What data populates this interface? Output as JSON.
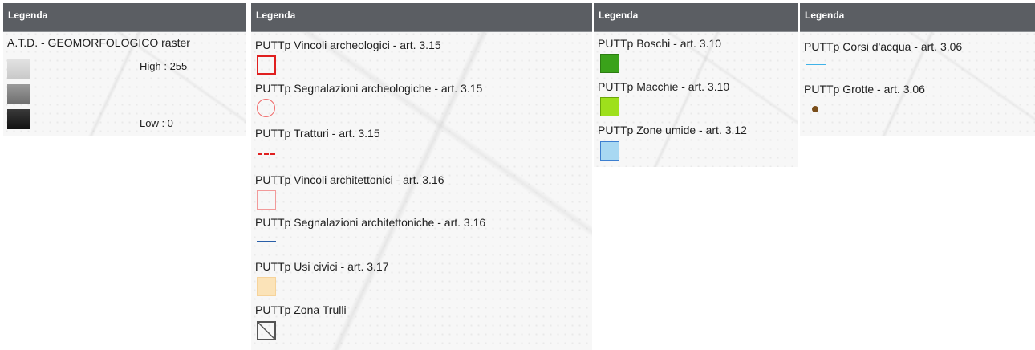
{
  "panels": [
    {
      "header": "Legenda",
      "layers": [
        {
          "title": "A.T.D. - GEOMORFOLOGICO raster",
          "high_label": "High : 255",
          "low_label": "Low : 0",
          "ramp_colors": [
            "#d4d4d4",
            "#8a8a8a",
            "#1c1c1c"
          ]
        }
      ]
    },
    {
      "header": "Legenda",
      "layers": [
        {
          "label": "PUTTp Vincoli archeologici - art. 3.15",
          "symbol": "square-outline",
          "color": "#e02020"
        },
        {
          "label": "PUTTp Segnalazioni archeologiche - art. 3.15",
          "symbol": "circle-outline",
          "color": "#f06a6a"
        },
        {
          "label": "PUTTp Tratturi - art. 3.15",
          "symbol": "dashed-line",
          "color": "#e02020"
        },
        {
          "label": "PUTTp Vincoli architettonici - art. 3.16",
          "symbol": "square-outline-light",
          "color": "#f29a9a"
        },
        {
          "label": "PUTTp Segnalazioni architettoniche - art. 3.16",
          "symbol": "solid-line",
          "color": "#2a5fa8"
        },
        {
          "label": "PUTTp Usi civici - art. 3.17",
          "symbol": "filled-square",
          "color": "#fbe3b8"
        },
        {
          "label": "PUTTp Zona Trulli",
          "symbol": "hatched-square",
          "color": "#555555"
        }
      ]
    },
    {
      "header": "Legenda",
      "layers": [
        {
          "label": "PUTTp Boschi - art. 3.10",
          "symbol": "filled-square",
          "color": "#3aa21a"
        },
        {
          "label": "PUTTp Macchie - art. 3.10",
          "symbol": "filled-square",
          "color": "#9ee01c"
        },
        {
          "label": "PUTTp Zone umide - art. 3.12",
          "symbol": "filled-square",
          "color": "#a8d8f2"
        }
      ]
    },
    {
      "header": "Legenda",
      "layers": [
        {
          "label": "PUTTp Corsi d'acqua - art. 3.06",
          "symbol": "solid-line",
          "color": "#3fb2e8"
        },
        {
          "label": "PUTTp Grotte - art. 3.06",
          "symbol": "dot",
          "color": "#7a4e1a"
        }
      ]
    }
  ]
}
